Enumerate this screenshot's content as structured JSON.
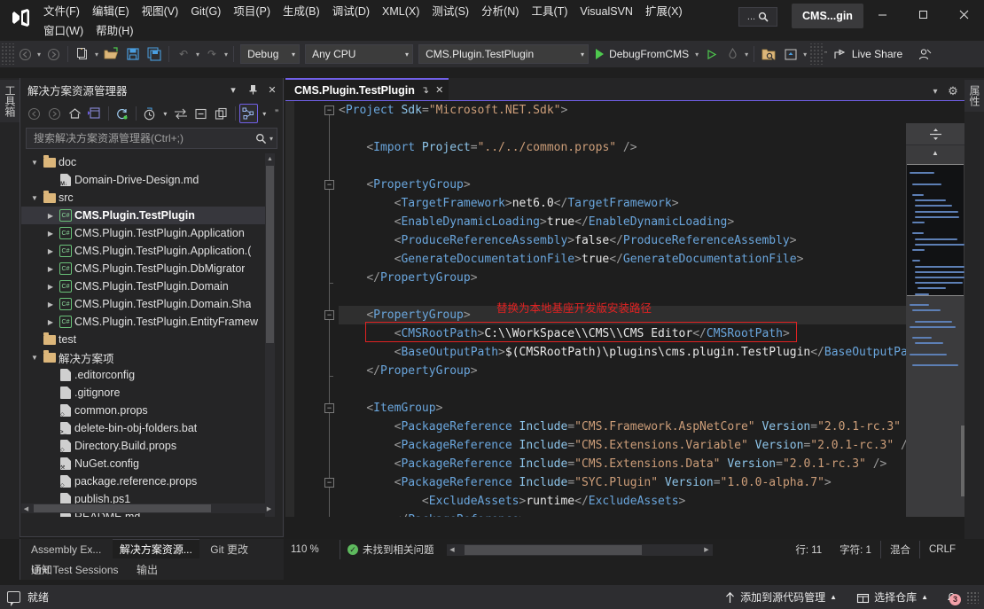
{
  "window": {
    "logo_icon": "visual-studio-logo",
    "solution_chip": "CMS...gin",
    "search_button_label": "...",
    "minimize": "—",
    "maximize": "☐",
    "close": "✕"
  },
  "menubar": {
    "row1": [
      {
        "label": "文件(F)"
      },
      {
        "label": "编辑(E)"
      },
      {
        "label": "视图(V)"
      },
      {
        "label": "Git(G)"
      },
      {
        "label": "项目(P)"
      },
      {
        "label": "生成(B)"
      },
      {
        "label": "调试(D)"
      },
      {
        "label": "XML(X)"
      },
      {
        "label": "测试(S)"
      },
      {
        "label": "分析(N)"
      },
      {
        "label": "工具(T)"
      },
      {
        "label": "VisualSVN"
      },
      {
        "label": "扩展(X)"
      }
    ],
    "row2": [
      {
        "label": "窗口(W)"
      },
      {
        "label": "帮助(H)"
      }
    ]
  },
  "toolbar": {
    "back_label": "←",
    "forward_label": "→",
    "new_item_label": "new-item",
    "open_label": "open-file",
    "save_label": "save",
    "save_all_label": "save-all",
    "undo_label": "↶",
    "redo_label": "↷",
    "config_combo": "Debug",
    "platform_combo": "Any CPU",
    "startup_combo": "CMS.Plugin.TestPlugin",
    "run_label": "DebugFromCMS",
    "live_share_label": "Live Share"
  },
  "left_dock": {
    "toolbox_tab": "工具箱"
  },
  "right_dock": {
    "properties_tab": "属性"
  },
  "solution_explorer": {
    "title": "解决方案资源管理器",
    "header_buttons": {
      "dropdown": "▾",
      "pin": "▮",
      "close": "✕"
    },
    "toolbar_icons": [
      {
        "name": "back-icon",
        "glyph": "←"
      },
      {
        "name": "forward-icon",
        "glyph": "→"
      },
      {
        "name": "home-icon",
        "glyph": "⌂"
      },
      {
        "name": "solution-views-icon",
        "glyph": "▤"
      },
      {
        "name": "refresh-icon",
        "glyph": "↻"
      },
      {
        "name": "pending-changes-icon",
        "glyph": "◴"
      },
      {
        "name": "sync-with-active-doc-icon",
        "glyph": "⇆"
      },
      {
        "name": "collapse-all-icon",
        "glyph": "⊟"
      },
      {
        "name": "show-all-files-icon",
        "glyph": "❑"
      },
      {
        "name": "preview-selected-items-icon",
        "glyph": "∴"
      },
      {
        "name": "overflow-icon",
        "glyph": "»"
      }
    ],
    "search_placeholder": "搜索解决方案资源管理器(Ctrl+;)",
    "search_value": "",
    "tree": [
      {
        "depth": 1,
        "arrow": "▼",
        "icon": "folder",
        "label": "doc",
        "selected": false
      },
      {
        "depth": 2,
        "arrow": "",
        "icon": "md",
        "label": "Domain-Drive-Design.md",
        "selected": false
      },
      {
        "depth": 1,
        "arrow": "▼",
        "icon": "folder",
        "label": "src",
        "selected": false
      },
      {
        "depth": 2,
        "arrow": "▶",
        "icon": "csproj",
        "label": "CMS.Plugin.TestPlugin",
        "selected": true
      },
      {
        "depth": 2,
        "arrow": "▶",
        "icon": "csproj",
        "label": "CMS.Plugin.TestPlugin.Application",
        "selected": false
      },
      {
        "depth": 2,
        "arrow": "▶",
        "icon": "csproj",
        "label": "CMS.Plugin.TestPlugin.Application.(",
        "selected": false
      },
      {
        "depth": 2,
        "arrow": "▶",
        "icon": "csproj",
        "label": "CMS.Plugin.TestPlugin.DbMigrator",
        "selected": false
      },
      {
        "depth": 2,
        "arrow": "▶",
        "icon": "csproj",
        "label": "CMS.Plugin.TestPlugin.Domain",
        "selected": false
      },
      {
        "depth": 2,
        "arrow": "▶",
        "icon": "csproj",
        "label": "CMS.Plugin.TestPlugin.Domain.Sha",
        "selected": false
      },
      {
        "depth": 2,
        "arrow": "▶",
        "icon": "csproj",
        "label": "CMS.Plugin.TestPlugin.EntityFramew",
        "selected": false
      },
      {
        "depth": 1,
        "arrow": "",
        "icon": "folder",
        "label": "test",
        "selected": false
      },
      {
        "depth": 1,
        "arrow": "▼",
        "icon": "folder",
        "label": "解决方案项",
        "selected": false
      },
      {
        "depth": 2,
        "arrow": "",
        "icon": "file",
        "label": ".editorconfig",
        "selected": false
      },
      {
        "depth": 2,
        "arrow": "",
        "icon": "file",
        "label": ".gitignore",
        "selected": false
      },
      {
        "depth": 2,
        "arrow": "",
        "icon": "props",
        "label": "common.props",
        "selected": false
      },
      {
        "depth": 2,
        "arrow": "",
        "icon": "bat",
        "label": "delete-bin-obj-folders.bat",
        "selected": false
      },
      {
        "depth": 2,
        "arrow": "",
        "icon": "props",
        "label": "Directory.Build.props",
        "selected": false
      },
      {
        "depth": 2,
        "arrow": "",
        "icon": "config",
        "label": "NuGet.config",
        "selected": false
      },
      {
        "depth": 2,
        "arrow": "",
        "icon": "props",
        "label": "package.reference.props",
        "selected": false
      },
      {
        "depth": 2,
        "arrow": "",
        "icon": "file",
        "label": "publish.ps1",
        "selected": false
      },
      {
        "depth": 2,
        "arrow": "",
        "icon": "md",
        "label": "README.md",
        "selected": false
      }
    ]
  },
  "dock_tabs": {
    "row1": [
      {
        "label": "Assembly Ex...",
        "active": false
      },
      {
        "label": "解决方案资源...",
        "active": true
      },
      {
        "label": "Git 更改",
        "active": false
      },
      {
        "label": "通知",
        "active": false
      }
    ],
    "row2": [
      {
        "label": "Unit Test Sessions",
        "active": false
      },
      {
        "label": "输出",
        "active": false
      }
    ]
  },
  "editor": {
    "tab_label": "CMS.Plugin.TestPlugin",
    "tab_pin": "↴",
    "tab_close": "✕",
    "tabstrip_right": [
      {
        "name": "tab-dropdown-icon",
        "glyph": "▾"
      },
      {
        "name": "settings-gear-icon",
        "glyph": "⚙"
      }
    ],
    "annotation": {
      "note": "替换为本地基座开发版安装路径",
      "color": "#e02222"
    },
    "lines": [
      {
        "n": 1,
        "indent": 0,
        "segs": [
          {
            "t": "<",
            "c": "punc"
          },
          {
            "t": "Project",
            "c": "tag"
          },
          {
            "t": " Sdk",
            "c": "attr"
          },
          {
            "t": "=",
            "c": "punc"
          },
          {
            "t": "\"Microsoft.NET.Sdk\"",
            "c": "str"
          },
          {
            "t": ">",
            "c": "punc"
          }
        ]
      },
      {
        "n": 2,
        "indent": 0,
        "segs": []
      },
      {
        "n": 3,
        "indent": 1,
        "segs": [
          {
            "t": "<",
            "c": "punc"
          },
          {
            "t": "Import",
            "c": "tag"
          },
          {
            "t": " Project",
            "c": "attr"
          },
          {
            "t": "=",
            "c": "punc"
          },
          {
            "t": "\"../../common.props\"",
            "c": "str"
          },
          {
            "t": " />",
            "c": "punc"
          }
        ]
      },
      {
        "n": 4,
        "indent": 0,
        "segs": []
      },
      {
        "n": 5,
        "indent": 1,
        "segs": [
          {
            "t": "<",
            "c": "punc"
          },
          {
            "t": "PropertyGroup",
            "c": "tag"
          },
          {
            "t": ">",
            "c": "punc"
          }
        ]
      },
      {
        "n": 6,
        "indent": 2,
        "segs": [
          {
            "t": "<",
            "c": "punc"
          },
          {
            "t": "TargetFramework",
            "c": "tag"
          },
          {
            "t": ">",
            "c": "punc"
          },
          {
            "t": "net6.0",
            "c": "txt"
          },
          {
            "t": "</",
            "c": "punc"
          },
          {
            "t": "TargetFramework",
            "c": "tag"
          },
          {
            "t": ">",
            "c": "punc"
          }
        ]
      },
      {
        "n": 7,
        "indent": 2,
        "segs": [
          {
            "t": "<",
            "c": "punc"
          },
          {
            "t": "EnableDynamicLoading",
            "c": "tag"
          },
          {
            "t": ">",
            "c": "punc"
          },
          {
            "t": "true",
            "c": "txt"
          },
          {
            "t": "</",
            "c": "punc"
          },
          {
            "t": "EnableDynamicLoading",
            "c": "tag"
          },
          {
            "t": ">",
            "c": "punc"
          }
        ]
      },
      {
        "n": 8,
        "indent": 2,
        "segs": [
          {
            "t": "<",
            "c": "punc"
          },
          {
            "t": "ProduceReferenceAssembly",
            "c": "tag"
          },
          {
            "t": ">",
            "c": "punc"
          },
          {
            "t": "false",
            "c": "txt"
          },
          {
            "t": "</",
            "c": "punc"
          },
          {
            "t": "ProduceReferenceAssembly",
            "c": "tag"
          },
          {
            "t": ">",
            "c": "punc"
          }
        ]
      },
      {
        "n": 9,
        "indent": 2,
        "segs": [
          {
            "t": "<",
            "c": "punc"
          },
          {
            "t": "GenerateDocumentationFile",
            "c": "tag"
          },
          {
            "t": ">",
            "c": "punc"
          },
          {
            "t": "true",
            "c": "txt"
          },
          {
            "t": "</",
            "c": "punc"
          },
          {
            "t": "GenerateDocumentationFile",
            "c": "tag"
          },
          {
            "t": ">",
            "c": "punc"
          }
        ]
      },
      {
        "n": 10,
        "indent": 1,
        "segs": [
          {
            "t": "</",
            "c": "punc"
          },
          {
            "t": "PropertyGroup",
            "c": "tag"
          },
          {
            "t": ">",
            "c": "punc"
          }
        ]
      },
      {
        "n": 11,
        "indent": 0,
        "segs": []
      },
      {
        "n": 12,
        "indent": 1,
        "segs": [
          {
            "t": "<",
            "c": "punc"
          },
          {
            "t": "PropertyGroup",
            "c": "tag"
          },
          {
            "t": ">",
            "c": "punc"
          }
        ]
      },
      {
        "n": 13,
        "indent": 2,
        "segs": [
          {
            "t": "<",
            "c": "punc"
          },
          {
            "t": "CMSRootPath",
            "c": "tag"
          },
          {
            "t": ">",
            "c": "punc"
          },
          {
            "t": "C:\\\\WorkSpace\\\\CMS\\\\CMS Editor",
            "c": "txt"
          },
          {
            "t": "</",
            "c": "punc"
          },
          {
            "t": "CMSRootPath",
            "c": "tag"
          },
          {
            "t": ">",
            "c": "punc"
          }
        ]
      },
      {
        "n": 14,
        "indent": 2,
        "segs": [
          {
            "t": "<",
            "c": "punc"
          },
          {
            "t": "BaseOutputPath",
            "c": "tag"
          },
          {
            "t": ">",
            "c": "punc"
          },
          {
            "t": "$(CMSRootPath)\\plugins\\cms.plugin.TestPlugin",
            "c": "txt"
          },
          {
            "t": "</",
            "c": "punc"
          },
          {
            "t": "BaseOutputPath",
            "c": "tag"
          },
          {
            "t": ">",
            "c": "punc"
          }
        ]
      },
      {
        "n": 15,
        "indent": 1,
        "segs": [
          {
            "t": "</",
            "c": "punc"
          },
          {
            "t": "PropertyGroup",
            "c": "tag"
          },
          {
            "t": ">",
            "c": "punc"
          }
        ]
      },
      {
        "n": 16,
        "indent": 0,
        "segs": []
      },
      {
        "n": 17,
        "indent": 1,
        "segs": [
          {
            "t": "<",
            "c": "punc"
          },
          {
            "t": "ItemGroup",
            "c": "tag"
          },
          {
            "t": ">",
            "c": "punc"
          }
        ]
      },
      {
        "n": 18,
        "indent": 2,
        "segs": [
          {
            "t": "<",
            "c": "punc"
          },
          {
            "t": "PackageReference",
            "c": "tag"
          },
          {
            "t": " Include",
            "c": "attr"
          },
          {
            "t": "=",
            "c": "punc"
          },
          {
            "t": "\"CMS.Framework.AspNetCore\"",
            "c": "str"
          },
          {
            "t": " Version",
            "c": "attr"
          },
          {
            "t": "=",
            "c": "punc"
          },
          {
            "t": "\"2.0.1-rc.3\"",
            "c": "str"
          },
          {
            "t": " />",
            "c": "punc"
          }
        ]
      },
      {
        "n": 19,
        "indent": 2,
        "segs": [
          {
            "t": "<",
            "c": "punc"
          },
          {
            "t": "PackageReference",
            "c": "tag"
          },
          {
            "t": " Include",
            "c": "attr"
          },
          {
            "t": "=",
            "c": "punc"
          },
          {
            "t": "\"CMS.Extensions.Variable\"",
            "c": "str"
          },
          {
            "t": " Version",
            "c": "attr"
          },
          {
            "t": "=",
            "c": "punc"
          },
          {
            "t": "\"2.0.1-rc.3\"",
            "c": "str"
          },
          {
            "t": " />",
            "c": "punc"
          }
        ]
      },
      {
        "n": 20,
        "indent": 2,
        "segs": [
          {
            "t": "<",
            "c": "punc"
          },
          {
            "t": "PackageReference",
            "c": "tag"
          },
          {
            "t": " Include",
            "c": "attr"
          },
          {
            "t": "=",
            "c": "punc"
          },
          {
            "t": "\"CMS.Extensions.Data\"",
            "c": "str"
          },
          {
            "t": " Version",
            "c": "attr"
          },
          {
            "t": "=",
            "c": "punc"
          },
          {
            "t": "\"2.0.1-rc.3\"",
            "c": "str"
          },
          {
            "t": " />",
            "c": "punc"
          }
        ]
      },
      {
        "n": 21,
        "indent": 2,
        "segs": [
          {
            "t": "<",
            "c": "punc"
          },
          {
            "t": "PackageReference",
            "c": "tag"
          },
          {
            "t": " Include",
            "c": "attr"
          },
          {
            "t": "=",
            "c": "punc"
          },
          {
            "t": "\"SYC.Plugin\"",
            "c": "str"
          },
          {
            "t": " Version",
            "c": "attr"
          },
          {
            "t": "=",
            "c": "punc"
          },
          {
            "t": "\"1.0.0-alpha.7\"",
            "c": "str"
          },
          {
            "t": ">",
            "c": "punc"
          }
        ]
      },
      {
        "n": 22,
        "indent": 3,
        "segs": [
          {
            "t": "<",
            "c": "punc"
          },
          {
            "t": "ExcludeAssets",
            "c": "tag"
          },
          {
            "t": ">",
            "c": "punc"
          },
          {
            "t": "runtime",
            "c": "txt"
          },
          {
            "t": "</",
            "c": "punc"
          },
          {
            "t": "ExcludeAssets",
            "c": "tag"
          },
          {
            "t": ">",
            "c": "punc"
          }
        ]
      },
      {
        "n": 23,
        "indent": 2,
        "segs": [
          {
            "t": "</",
            "c": "punc"
          },
          {
            "t": "PackageReference",
            "c": "tag"
          },
          {
            "t": ">",
            "c": "punc"
          }
        ]
      }
    ]
  },
  "editor_status": {
    "zoom": "110 %",
    "zoom_caret": "▾",
    "problems": "未找到相关问题",
    "line": "行: 11",
    "column": "字符: 1",
    "indent_mode": "混合",
    "line_ending": "CRLF"
  },
  "statusbar": {
    "ready": "就绪",
    "source_control_label": "添加到源代码管理",
    "repo_label": "选择仓库",
    "notification_count": "3"
  }
}
